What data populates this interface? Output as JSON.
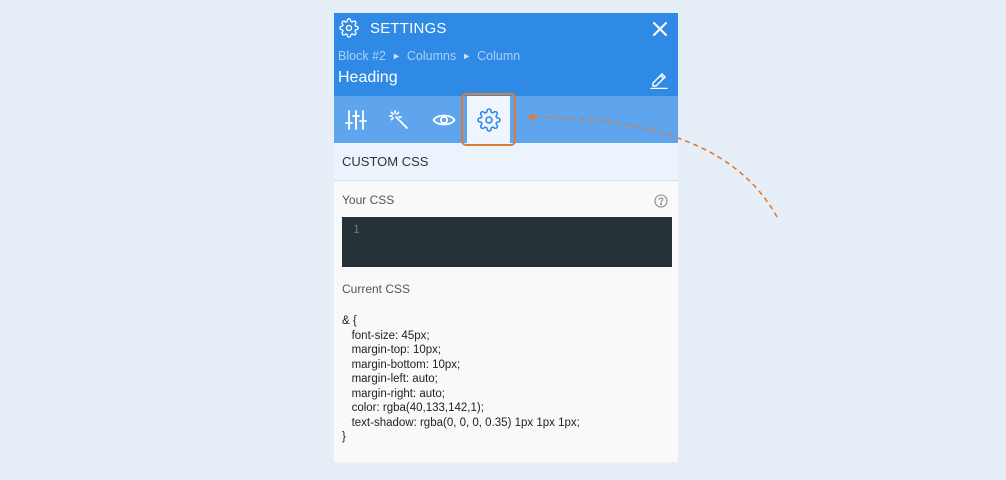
{
  "header": {
    "title": "SETTINGS",
    "breadcrumb": [
      "Block #2",
      "Columns",
      "Column"
    ],
    "breadcrumb_separator": "►",
    "heading": "Heading"
  },
  "tabs": [
    {
      "name": "sliders-icon",
      "active": false
    },
    {
      "name": "magic-wand-icon",
      "active": false
    },
    {
      "name": "eye-icon",
      "active": false
    },
    {
      "name": "gear-icon",
      "active": true
    }
  ],
  "section": {
    "title": "CUSTOM CSS",
    "your_css_label": "Your CSS",
    "editor_line_number": "1",
    "current_css_label": "Current CSS",
    "current_css_lines": [
      "& {",
      "   font-size: 45px;",
      "   margin-top: 10px;",
      "   margin-bottom: 10px;",
      "   margin-left: auto;",
      "   margin-right: auto;",
      "   color: rgba(40,133,142,1);",
      "   text-shadow: rgba(0, 0, 0, 0.35) 1px 1px 1px;",
      "}"
    ]
  },
  "colors": {
    "header": "#2f8ae6",
    "tab_bar": "#5ea5ee",
    "highlight": "#e07b35",
    "editor": "#263238"
  }
}
